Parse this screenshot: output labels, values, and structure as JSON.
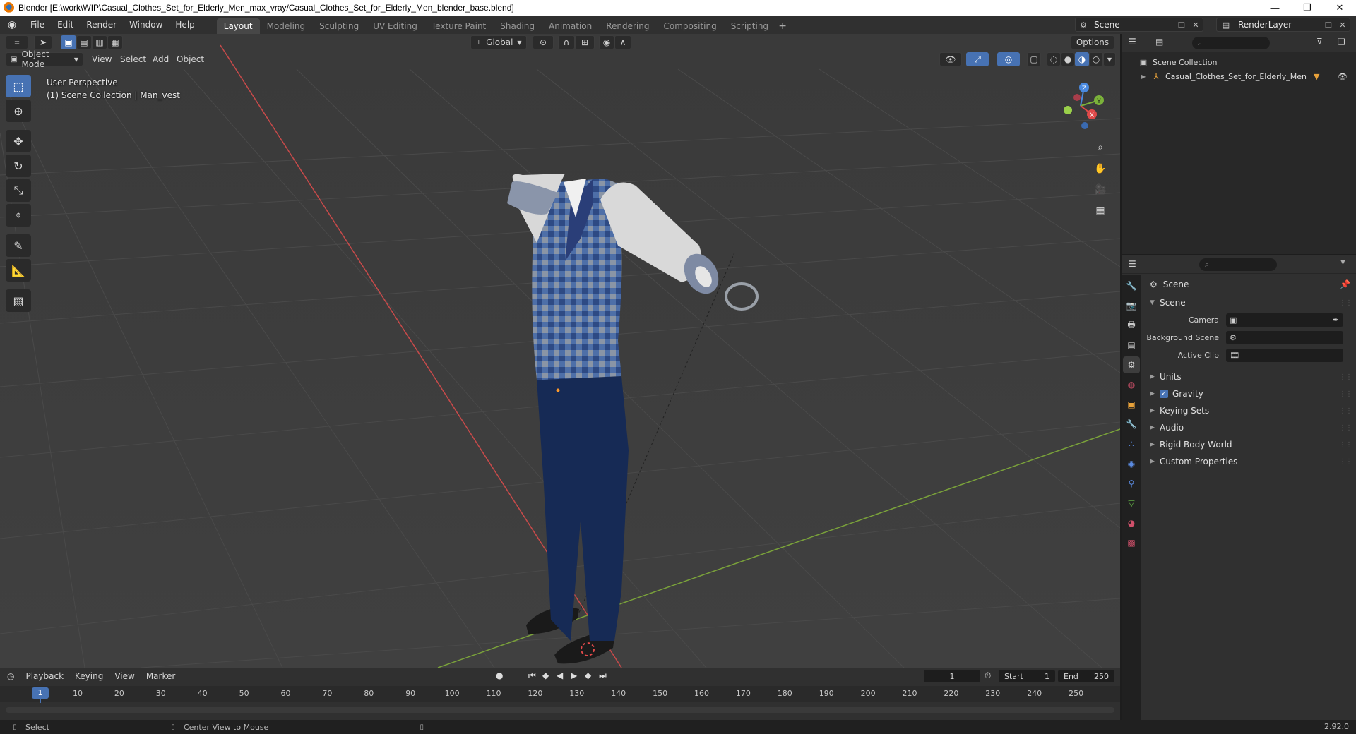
{
  "window": {
    "title": "Blender [E:\\work\\WIP\\Casual_Clothes_Set_for_Elderly_Men_max_vray/Casual_Clothes_Set_for_Elderly_Men_blender_base.blend]",
    "min_icon": "—",
    "max_icon": "❐",
    "close_icon": "✕"
  },
  "menu": {
    "items": [
      "File",
      "Edit",
      "Render",
      "Window",
      "Help"
    ]
  },
  "workspaces": {
    "tabs": [
      "Layout",
      "Modeling",
      "Sculpting",
      "UV Editing",
      "Texture Paint",
      "Shading",
      "Animation",
      "Rendering",
      "Compositing",
      "Scripting"
    ],
    "active": "Layout",
    "add": "+"
  },
  "scene_selector": {
    "value": "Scene"
  },
  "layer_selector": {
    "value": "RenderLayer"
  },
  "viewport": {
    "mode": "Object Mode",
    "menus": [
      "View",
      "Select",
      "Add",
      "Object"
    ],
    "transform_orientation": "Global",
    "options_label": "Options",
    "perspective_label": "User Perspective",
    "collection_label": "(1) Scene Collection | Man_vest",
    "gizmo": {
      "x": "X",
      "y": "Y",
      "z": "Z"
    }
  },
  "outliner": {
    "search_placeholder": "",
    "rows": [
      {
        "label": "Scene Collection"
      },
      {
        "label": "Casual_Clothes_Set_for_Elderly_Men"
      }
    ]
  },
  "properties": {
    "context_title": "Scene",
    "panel_title": "Scene",
    "fields": [
      {
        "label": "Camera",
        "value": ""
      },
      {
        "label": "Background Scene",
        "value": ""
      },
      {
        "label": "Active Clip",
        "value": ""
      }
    ],
    "panels": [
      {
        "label": "Units",
        "checkbox": false
      },
      {
        "label": "Gravity",
        "checkbox": true
      },
      {
        "label": "Keying Sets",
        "checkbox": false
      },
      {
        "label": "Audio",
        "checkbox": false
      },
      {
        "label": "Rigid Body World",
        "checkbox": false
      },
      {
        "label": "Custom Properties",
        "checkbox": false
      }
    ]
  },
  "timeline": {
    "menus": [
      "Playback",
      "Keying",
      "View",
      "Marker"
    ],
    "current_frame": "1",
    "start_label": "Start",
    "start_value": "1",
    "end_label": "End",
    "end_value": "250",
    "ruler_labels": [
      "1",
      "10",
      "20",
      "30",
      "40",
      "50",
      "60",
      "70",
      "80",
      "90",
      "100",
      "110",
      "120",
      "130",
      "140",
      "150",
      "160",
      "170",
      "180",
      "190",
      "200",
      "210",
      "220",
      "230",
      "240",
      "250"
    ]
  },
  "status": {
    "select": "Select",
    "center_view": "Center View to Mouse",
    "version": "2.92.0"
  },
  "colors": {
    "accent": "#4772b3",
    "x_axis": "#e04a4a",
    "y_axis": "#7bb23a",
    "z_axis": "#4a8ae0"
  }
}
